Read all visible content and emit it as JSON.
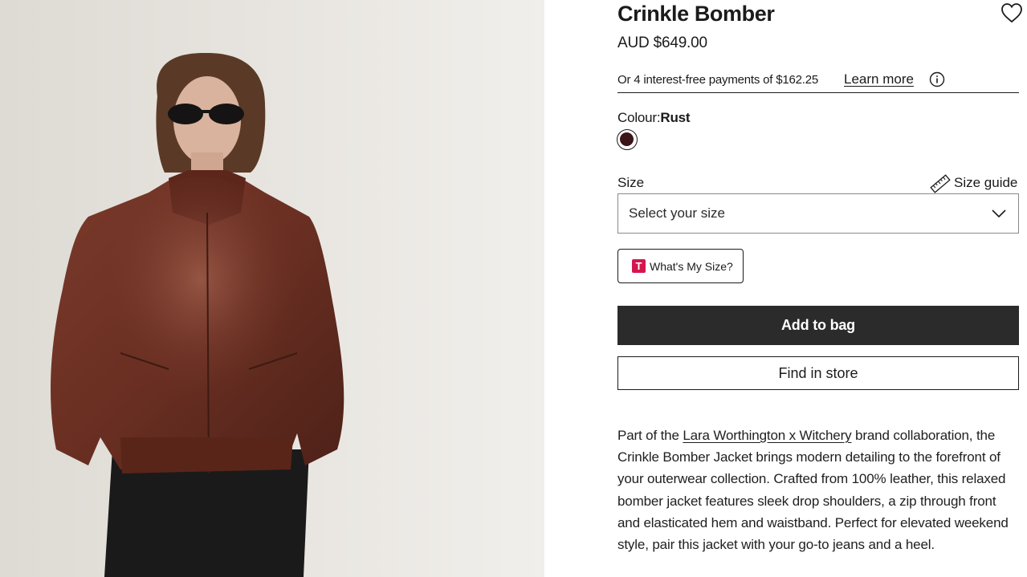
{
  "product": {
    "title": "Crinkle Bomber",
    "price": "AUD $649.00",
    "image_alt": "Model wearing rust leather bomber jacket"
  },
  "installments": {
    "text": "Or 4 interest-free payments of $162.25",
    "learn_more": "Learn more"
  },
  "colour": {
    "label": "Colour:",
    "value": "Rust",
    "swatch_color": "#3b1518"
  },
  "size": {
    "label": "Size",
    "guide_label": "Size guide",
    "select_placeholder": "Select your size"
  },
  "whats_my_size": {
    "logo_letter": "T",
    "label": "What's My Size?"
  },
  "actions": {
    "add_to_bag": "Add to bag",
    "find_in_store": "Find in store"
  },
  "description": {
    "before_link": "Part of the ",
    "link_text": "Lara Worthington x Witchery",
    "after_link": " brand collaboration, the Crinkle Bomber Jacket brings modern detailing to the forefront of your outerwear collection. Crafted from 100% leather, this relaxed bomber jacket features sleek drop shoulders, a zip through front and elasticated hem and waistband. Perfect for elevated weekend style, pair this jacket with your go-to jeans and a heel."
  },
  "icons": {
    "wishlist": "heart-icon",
    "info": "info-icon",
    "size_guide": "ruler-icon",
    "dropdown": "chevron-down-icon"
  },
  "colors": {
    "primary_button": "#2b2b2b",
    "image_background": "#ece9e4",
    "jacket": "#6e3326"
  }
}
